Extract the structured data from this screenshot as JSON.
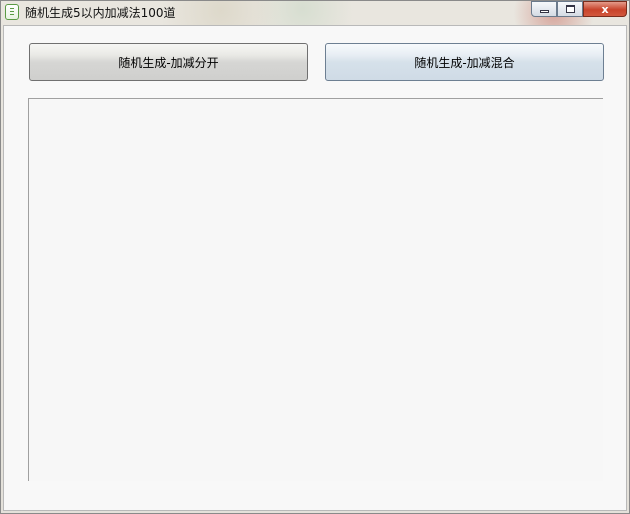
{
  "window": {
    "title": "随机生成5以内加减法100道",
    "minimize_icon": "minimize-icon",
    "maximize_icon": "maximize-icon",
    "close_label": "x"
  },
  "buttons": {
    "separate_label": "随机生成-加减分开",
    "mixed_label": "随机生成-加减混合"
  },
  "output": {
    "content": ""
  }
}
